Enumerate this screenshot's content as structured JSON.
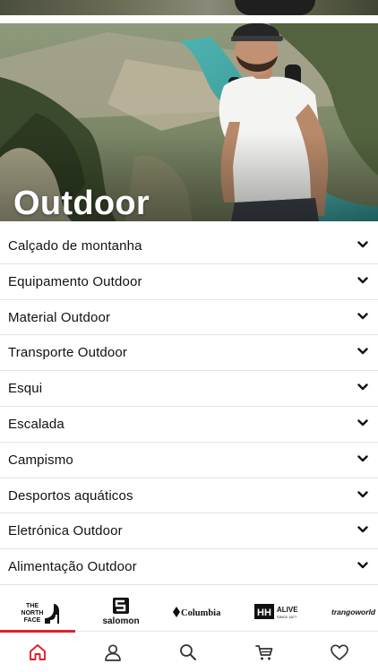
{
  "hero": {
    "title": "Outdoor"
  },
  "categories": [
    {
      "label": "Calçado de montanha"
    },
    {
      "label": "Equipamento Outdoor"
    },
    {
      "label": "Material Outdoor"
    },
    {
      "label": "Transporte Outdoor"
    },
    {
      "label": "Esqui"
    },
    {
      "label": "Escalada"
    },
    {
      "label": "Campismo"
    },
    {
      "label": "Desportos aquáticos"
    },
    {
      "label": "Eletrónica Outdoor"
    },
    {
      "label": "Alimentação Outdoor"
    }
  ],
  "brands": {
    "the_north_face": {
      "line1": "THE",
      "line2": "NORTH",
      "line3": "FACE"
    },
    "salomon": {
      "name": "salomon"
    },
    "columbia": {
      "name": "Columbia"
    },
    "helly_hansen": {
      "mark": "HH",
      "tag": "ALIVE",
      "sub": "SINCE 1877"
    },
    "trangoworld": {
      "name": "trangoworld"
    }
  },
  "bottom_nav": {
    "active": "home",
    "items": [
      "home-icon",
      "account-icon",
      "search-icon",
      "cart-icon",
      "wishlist-icon"
    ]
  },
  "colors": {
    "accent": "#d9232d",
    "text": "#111111",
    "divider": "#e2e2e2"
  }
}
